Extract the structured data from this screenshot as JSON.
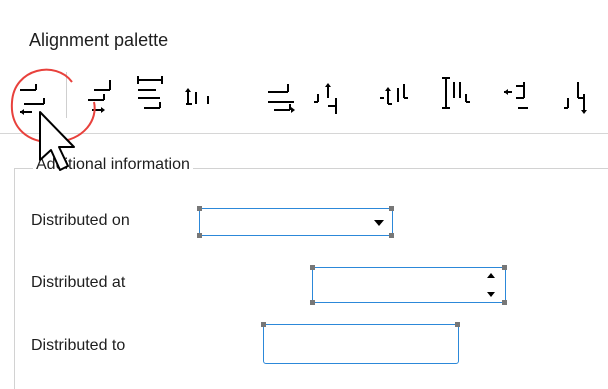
{
  "palette": {
    "title": "Alignment palette",
    "tools": [
      {
        "icon": "align-left-edge-icon"
      },
      {
        "icon": "align-right-edge-icon"
      },
      {
        "icon": "distribute-horizontal-icon"
      },
      {
        "icon": "align-tops-icon"
      },
      {
        "icon": "align-right-stack-icon"
      },
      {
        "icon": "align-bottom-up-icon"
      },
      {
        "icon": "align-vertical-centers-icon"
      },
      {
        "icon": "distribute-vertical-icon"
      },
      {
        "icon": "align-left-stack-icon"
      },
      {
        "icon": "align-bottoms-icon"
      }
    ]
  },
  "group": {
    "title": "Additional information"
  },
  "fields": {
    "distributed_on": {
      "label": "Distributed on",
      "value": ""
    },
    "distributed_at": {
      "label": "Distributed at",
      "value": ""
    },
    "distributed_to": {
      "label": "Distributed to",
      "value": ""
    }
  },
  "colors": {
    "focus_border": "#2c88d9",
    "highlight_circle": "#e8413c"
  }
}
